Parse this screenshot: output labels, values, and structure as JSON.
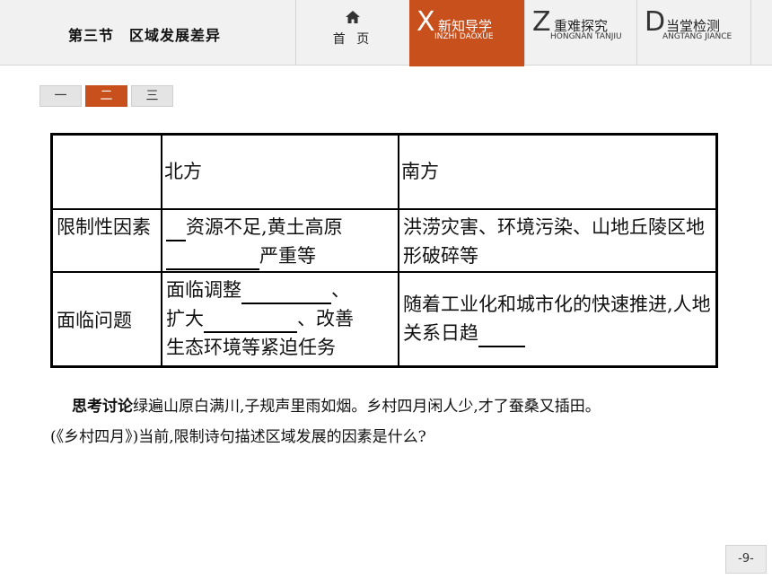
{
  "header": {
    "section_title": "第三节　区域发展差异",
    "home_label": "首 页",
    "tabs": [
      {
        "letter": "X",
        "label": "新知导学",
        "pinyin": "INZHI DAOXUE",
        "active": true
      },
      {
        "letter": "Z",
        "label": "重难探究",
        "pinyin": "HONGNAN TANJIU",
        "active": false
      },
      {
        "letter": "D",
        "label": "当堂检测",
        "pinyin": "ANGTANG JIANCE",
        "active": false
      }
    ]
  },
  "subtabs": [
    {
      "label": "一",
      "active": false
    },
    {
      "label": "二",
      "active": true
    },
    {
      "label": "三",
      "active": false
    }
  ],
  "table": {
    "headers": [
      "",
      "北方",
      "南方"
    ],
    "row1_label": "限制性因素",
    "row1_north_text1": "资源不足,黄土高原",
    "row1_north_text2": "严重等",
    "row1_south": "洪涝灾害、环境污染、山地丘陵区地形破碎等",
    "row2_label": "面临问题",
    "row2_north_text1": "面临调整",
    "row2_north_text2": "、",
    "row2_north_text3": "扩大",
    "row2_north_text4": "、改善",
    "row2_north_text5": "生态环境等紧迫任务",
    "row2_south": "随着工业化和城市化的快速推进,人地关系日趋"
  },
  "discussion": {
    "lead": "思考讨论",
    "line1": "绿遍山原白满川,子规声里雨如烟。乡村四月闲人少,才了蚕桑又插田。",
    "line2": "(《乡村四月》)当前,限制诗句描述区域发展的因素是什么?"
  },
  "page_number": "-9-",
  "colors": {
    "accent": "#c8501c",
    "bar_bg": "#f1f1f1"
  }
}
